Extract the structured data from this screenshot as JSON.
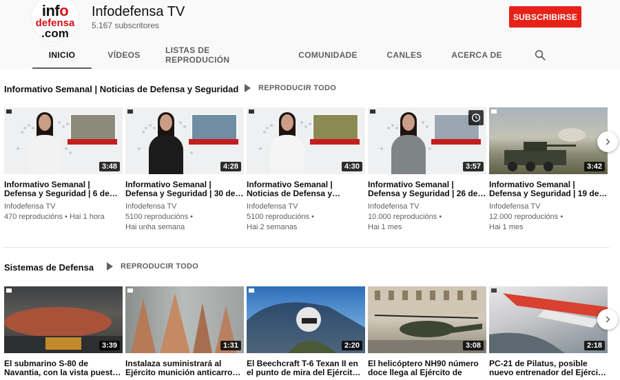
{
  "channel": {
    "logo_text": {
      "line1_a": "inf",
      "line1_b": "o",
      "line2": "defensa",
      "line3": ".com"
    },
    "name": "Infodefensa TV",
    "subscribers": "5.167 subscritores",
    "subscribe_label": "SUBSCRIBIRSE"
  },
  "tabs": [
    {
      "label": "INICIO",
      "active": true
    },
    {
      "label": "VÍDEOS"
    },
    {
      "label": "LISTAS DE REPRODUCIÓN"
    },
    {
      "label": "COMUNIDADE"
    },
    {
      "label": "CANLES"
    },
    {
      "label": "ACERCA DE"
    }
  ],
  "icons": {
    "search": "search-icon",
    "next": "chevron-right-icon",
    "play": "play-icon",
    "clock": "clock-icon"
  },
  "colors": {
    "subscribe": "#e62117",
    "text_secondary": "#606060"
  },
  "shelves": [
    {
      "title": "Informativo Semanal | Noticias de Defensa y Seguridad",
      "play_all": "REPRODUCIR TODO",
      "videos": [
        {
          "title_l1": "Informativo Semanal |",
          "title_l2": "Defensa y Seguridad | 6 de…",
          "channel": "Infodefensa TV",
          "views": "470 reproducións • Hai 1 hora",
          "age": "",
          "duration": "3:48"
        },
        {
          "title_l1": "Informativo Semanal |",
          "title_l2": "Defensa y Seguridad | 30 de…",
          "channel": "Infodefensa TV",
          "views": "5100 reproducións •",
          "age": "Hai unha semana",
          "duration": "4:28"
        },
        {
          "title_l1": "Informativo Semanal |",
          "title_l2": "Noticias de Defensa y…",
          "channel": "Infodefensa TV",
          "views": "5100 reproducións •",
          "age": "Hai 2 semanas",
          "duration": "4:30"
        },
        {
          "title_l1": "Informativo Semanal |",
          "title_l2": "Defensa y Seguridad | 26 de…",
          "channel": "Infodefensa TV",
          "views": "10.000 reproducións •",
          "age": "Hai 1 mes",
          "duration": "3:57"
        },
        {
          "title_l1": "Informativo Semanal |",
          "title_l2": "Defensa y Seguridad | 19 de…",
          "channel": "Infodefensa TV",
          "views": "12.000 reproducións •",
          "age": "Hai 1 mes",
          "duration": "3:42"
        }
      ]
    },
    {
      "title": "Sistemas de Defensa",
      "play_all": "REPRODUCIR TODO",
      "videos": [
        {
          "title_l1": "El submarino S-80 de",
          "title_l2": "Navantia, con la vista puest…",
          "duration": "3:39"
        },
        {
          "title_l1": "Instalaza suministrará al",
          "title_l2": "Ejército munición anticarro…",
          "duration": "1:31"
        },
        {
          "title_l1": "El Beechcraft T-6 Texan II en",
          "title_l2": "el punto de mira del Ejército…",
          "duration": "2:20"
        },
        {
          "title_l1": "El helicóptero NH90 número",
          "title_l2": "doce llega al Ejército de",
          "duration": "3:08"
        },
        {
          "title_l1": "PC-21 de Pilatus, posible",
          "title_l2": "nuevo entrenador del Ejércit…",
          "duration": "2:18"
        }
      ]
    }
  ]
}
